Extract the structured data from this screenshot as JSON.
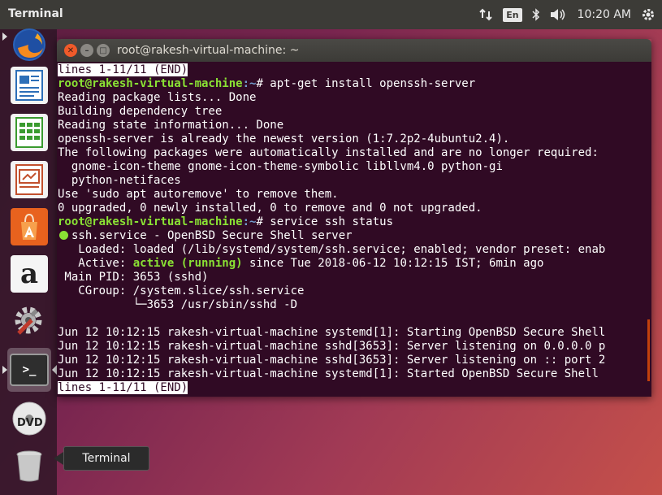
{
  "top_panel": {
    "app_name": "Terminal",
    "keyboard_layout": "En",
    "clock": "10:20 AM",
    "icons": [
      "transfer-icon",
      "keyboard-icon",
      "bluetooth-icon",
      "volume-icon",
      "gear-icon"
    ]
  },
  "launcher": {
    "items": [
      {
        "name": "Firefox",
        "icon": "firefox-icon"
      },
      {
        "name": "LibreOffice Writer",
        "icon": "writer-icon"
      },
      {
        "name": "LibreOffice Calc",
        "icon": "calc-icon"
      },
      {
        "name": "LibreOffice Impress",
        "icon": "impress-icon"
      },
      {
        "name": "Ubuntu Software",
        "icon": "software-center-icon"
      },
      {
        "name": "Amazon",
        "icon": "amazon-icon"
      },
      {
        "name": "System Settings",
        "icon": "settings-icon"
      },
      {
        "name": "Terminal",
        "icon": "terminal-icon"
      },
      {
        "name": "DVD",
        "icon": "dvd-icon"
      },
      {
        "name": "Trash",
        "icon": "trash-icon"
      }
    ],
    "tooltip": "Terminal"
  },
  "window": {
    "title": "root@rakesh-virtual-machine: ~"
  },
  "terminal": {
    "pager_status_top": "lines 1-11/11 (END)",
    "prompt_user": "root@rakesh-virtual-machine",
    "prompt_path": ":~",
    "prompt_symbol": "# ",
    "cmd1": "apt-get install openssh-server",
    "out1": [
      "Reading package lists... Done",
      "Building dependency tree",
      "Reading state information... Done",
      "openssh-server is already the newest version (1:7.2p2-4ubuntu2.4).",
      "The following packages were automatically installed and are no longer required:",
      "  gnome-icon-theme gnome-icon-theme-symbolic libllvm4.0 python-gi",
      "  python-netifaces",
      "Use 'sudo apt autoremove' to remove them.",
      "0 upgraded, 0 newly installed, 0 to remove and 0 not upgraded."
    ],
    "cmd2": "service ssh status",
    "service_name": "ssh.service - OpenBSD Secure Shell server",
    "loaded_line": "   Loaded: loaded (/lib/systemd/system/ssh.service; enabled; vendor preset: enab",
    "active_label": "   Active: ",
    "active_state": "active (running)",
    "active_rest": " since Tue 2018-06-12 10:12:15 IST; 6min ago",
    "main_pid": " Main PID: 3653 (sshd)",
    "cgroup": "   CGroup: /system.slice/ssh.service",
    "cgroup_child": "           └─3653 /usr/sbin/sshd -D",
    "log": [
      "Jun 12 10:12:15 rakesh-virtual-machine systemd[1]: Starting OpenBSD Secure Shell",
      "Jun 12 10:12:15 rakesh-virtual-machine sshd[3653]: Server listening on 0.0.0.0 p",
      "Jun 12 10:12:15 rakesh-virtual-machine sshd[3653]: Server listening on :: port 2",
      "Jun 12 10:12:15 rakesh-virtual-machine systemd[1]: Started OpenBSD Secure Shell"
    ],
    "pager_status_bottom": "lines 1-11/11 (END)"
  },
  "colors": {
    "terminal_bg": "#300a24",
    "prompt_user": "#8ae234",
    "prompt_path": "#729fcf",
    "panel_bg": "#3c3b37"
  }
}
